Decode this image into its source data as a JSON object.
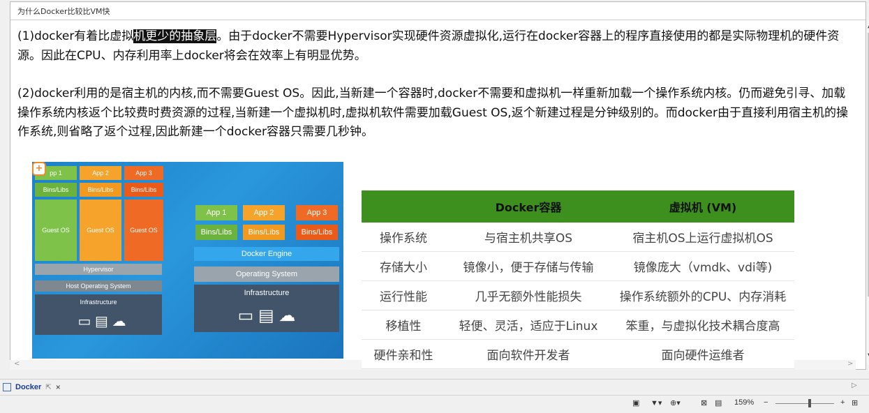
{
  "doc": {
    "title": "为什么Docker比较比VM快",
    "p1_before": "(1)docker有着比虚拟",
    "p1_highlight": "机更少的抽象层",
    "p1_after": "。由于docker不需要Hypervisor实现硬件资源虚拟化,运行在docker容器上的程序直接使用的都是实际物理机的硬件资源。因此在CPU、内存利用率上docker将会在效率上有明显优势。",
    "p2": "(2)docker利用的是宿主机的内核,而不需要Guest OS。因此,当新建一个容器时,docker不需要和虚拟机一样重新加载一个操作系统内核。仍而避免引寻、加载操作系统内核返个比较费时费资源的过程,当新建一个虚拟机时,虚拟机软件需要加载Guest OS,返个新建过程是分钟级别的。而docker由于直接利用宿主机的操作系统,则省略了返个过程,因此新建一个docker容器只需要几秒钟。"
  },
  "diagram": {
    "vm_apps": [
      "App 1",
      "App 2",
      "App 3"
    ],
    "vm_bins": [
      "Bins/Libs",
      "Bins/Libs",
      "Bins/Libs"
    ],
    "vm_guest": [
      "Guest OS",
      "Guest OS",
      "Guest OS"
    ],
    "vm_hypervisor": "Hypervisor",
    "vm_host": "Host Operating System",
    "vm_infra": "Infrastructure",
    "dk_apps": [
      "App 1",
      "App 2",
      "App 3"
    ],
    "dk_bins": [
      "Bins/Libs",
      "Bins/Libs",
      "Bins/Libs"
    ],
    "dk_engine": "Docker Engine",
    "dk_os": "Operating System",
    "dk_infra": "Infrastructure",
    "app1_visible": "pp 1"
  },
  "table": {
    "headers": [
      "",
      "Docker容器",
      "虚拟机 (VM)"
    ],
    "rows": [
      [
        "操作系统",
        "与宿主机共享OS",
        "宿主机OS上运行虚拟机OS"
      ],
      [
        "存储大小",
        "镜像小，便于存储与传输",
        "镜像庞大（vmdk、vdi等)"
      ],
      [
        "运行性能",
        "几乎无额外性能损失",
        "操作系统额外的CPU、内存消耗"
      ],
      [
        "移植性",
        "轻便、灵活，适应于Linux",
        "笨重，与虚拟化技术耦合度高"
      ],
      [
        "硬件亲和性",
        "面向软件开发者",
        "面向硬件运维者"
      ]
    ]
  },
  "tabbar": {
    "tab_label": "Docker"
  },
  "statusbar": {
    "zoom": "159%",
    "minus": "−",
    "plus": "+"
  },
  "colors": {
    "table_header": "#3d8f1e",
    "diagram_bg": "#1c80c8",
    "highlight": "#111111"
  }
}
